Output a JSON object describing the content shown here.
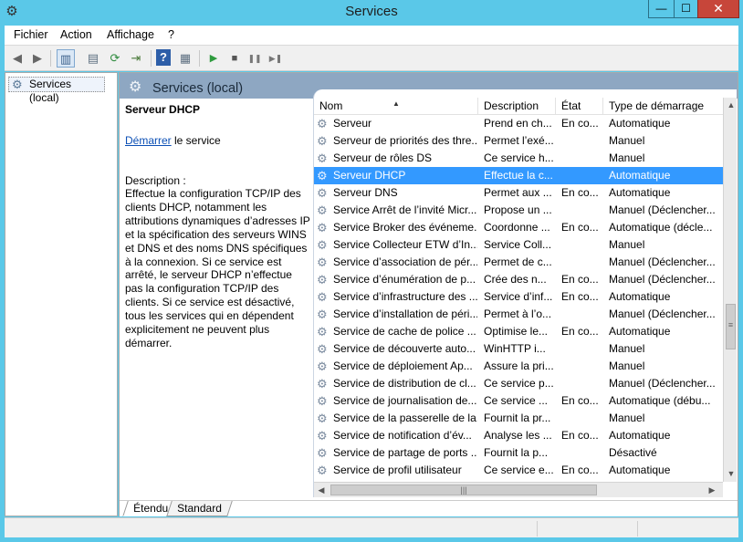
{
  "window": {
    "title": "Services",
    "app_icon": "gear-icon",
    "controls": {
      "minimize": "—",
      "maximize": "☐",
      "close": "✕"
    }
  },
  "menu": {
    "items": [
      {
        "label": "Fichier"
      },
      {
        "label": "Action"
      },
      {
        "label": "Affichage"
      },
      {
        "label": "?"
      }
    ]
  },
  "toolbar": {
    "buttons": [
      {
        "icon": "back-arrow-icon",
        "glyph": "◀"
      },
      {
        "icon": "forward-arrow-icon",
        "glyph": "▶"
      },
      {
        "icon": "show-hide-tree-icon",
        "glyph": "▥"
      },
      {
        "icon": "properties-icon",
        "glyph": "▤"
      },
      {
        "icon": "refresh-icon",
        "glyph": "⟳"
      },
      {
        "icon": "export-list-icon",
        "glyph": "⇥"
      },
      {
        "icon": "help-icon",
        "glyph": "?"
      },
      {
        "icon": "help-panel-icon",
        "glyph": "▦"
      },
      {
        "icon": "start-service-icon",
        "glyph": "▶"
      },
      {
        "icon": "stop-service-icon",
        "glyph": "■"
      },
      {
        "icon": "pause-service-icon",
        "glyph": "❚❚"
      },
      {
        "icon": "restart-service-icon",
        "glyph": "▶❚"
      }
    ]
  },
  "tree": {
    "root": {
      "label": "Services (local)",
      "icon": "gear-icon"
    }
  },
  "content": {
    "header_title": "Services (local)",
    "header_icon": "gear-icon"
  },
  "details": {
    "title": "Serveur DHCP",
    "start_link": "Démarrer",
    "start_suffix": " le service",
    "description_label": "Description :",
    "description": "Effectue la configuration TCP/IP des clients DHCP, notamment les attributions dynamiques d’adresses IP et la spécification des serveurs WINS et DNS et des noms DNS spécifiques à la connexion. Si ce service est arrêté, le serveur DHCP n’effectue pas la configuration TCP/IP des clients. Si ce service est désactivé, tous les services qui en dépendent explicitement ne peuvent plus démarrer."
  },
  "list": {
    "columns": {
      "name": "Nom",
      "description": "Description",
      "state": "État",
      "startup": "Type de démarrage"
    },
    "sort_indicator": "▲",
    "rows": [
      {
        "name": "Serveur",
        "description": "Prend en ch...",
        "state": "En co...",
        "startup": "Automatique"
      },
      {
        "name": "Serveur de priorités des thre...",
        "description": "Permet l’exé...",
        "state": "",
        "startup": "Manuel"
      },
      {
        "name": "Serveur de rôles DS",
        "description": "Ce service h...",
        "state": "",
        "startup": "Manuel"
      },
      {
        "name": "Serveur DHCP",
        "description": "Effectue la c...",
        "state": "",
        "startup": "Automatique",
        "selected": true
      },
      {
        "name": "Serveur DNS",
        "description": "Permet aux ...",
        "state": "En co...",
        "startup": "Automatique"
      },
      {
        "name": "Service Arrêt de l’invité Micr...",
        "description": "Propose un ...",
        "state": "",
        "startup": "Manuel (Déclencher..."
      },
      {
        "name": "Service Broker des événeme...",
        "description": "Coordonne ...",
        "state": "En co...",
        "startup": "Automatique (décle..."
      },
      {
        "name": "Service Collecteur ETW d’In...",
        "description": "Service Coll...",
        "state": "",
        "startup": "Manuel"
      },
      {
        "name": "Service d’association de pér...",
        "description": "Permet de c...",
        "state": "",
        "startup": "Manuel (Déclencher..."
      },
      {
        "name": "Service d’énumération de p...",
        "description": "Crée des n...",
        "state": "En co...",
        "startup": "Manuel (Déclencher..."
      },
      {
        "name": "Service d’infrastructure des ...",
        "description": "Service d’inf...",
        "state": "En co...",
        "startup": "Automatique"
      },
      {
        "name": "Service d’installation de péri...",
        "description": "Permet à l’o...",
        "state": "",
        "startup": "Manuel (Déclencher..."
      },
      {
        "name": "Service de cache de police ...",
        "description": "Optimise le...",
        "state": "En co...",
        "startup": "Automatique"
      },
      {
        "name": "Service de découverte auto...",
        "description": "WinHTTP i...",
        "state": "",
        "startup": "Manuel"
      },
      {
        "name": "Service de déploiement Ap...",
        "description": "Assure la pri...",
        "state": "",
        "startup": "Manuel"
      },
      {
        "name": "Service de distribution de cl...",
        "description": "Ce service p...",
        "state": "",
        "startup": "Manuel (Déclencher..."
      },
      {
        "name": "Service de journalisation de...",
        "description": "Ce service ...",
        "state": "En co...",
        "startup": "Automatique (débu..."
      },
      {
        "name": "Service de la passerelle de la...",
        "description": "Fournit la pr...",
        "state": "",
        "startup": "Manuel"
      },
      {
        "name": "Service de notification d’év...",
        "description": "Analyse les ...",
        "state": "En co...",
        "startup": "Automatique"
      },
      {
        "name": "Service de partage de ports ...",
        "description": "Fournit la p...",
        "state": "",
        "startup": "Désactivé"
      },
      {
        "name": "Service de profil utilisateur",
        "description": "Ce service e...",
        "state": "En co...",
        "startup": "Automatique"
      }
    ],
    "row_icon": "gear-icon",
    "scroll_position_fraction": 0.62
  },
  "tabs": [
    {
      "label": "Étendu",
      "active": true
    },
    {
      "label": "Standard",
      "active": false
    }
  ]
}
